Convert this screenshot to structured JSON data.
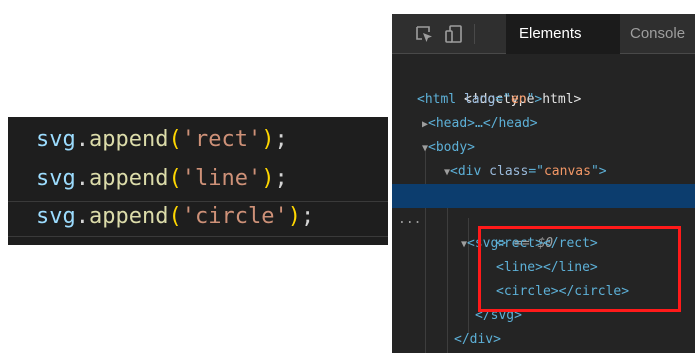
{
  "code_panel": {
    "lines": [
      {
        "obj": "svg",
        "dot": ".",
        "method": "append",
        "open": "(",
        "arg": "'rect'",
        "close": ")",
        "semi": ";"
      },
      {
        "obj": "svg",
        "dot": ".",
        "method": "append",
        "open": "(",
        "arg": "'line'",
        "close": ")",
        "semi": ";"
      },
      {
        "obj": "svg",
        "dot": ".",
        "method": "append",
        "open": "(",
        "arg": "'circle'",
        "close": ")",
        "semi": ";"
      }
    ]
  },
  "devtools": {
    "toolbar": {
      "inspect_icon": "inspect-element-icon",
      "device_icon": "device-toolbar-icon",
      "tabs": [
        {
          "label": "Elements",
          "active": true
        },
        {
          "label": "Console",
          "active": false
        }
      ]
    },
    "tree": {
      "doctype": "<!doctype html>",
      "html_open": "<html",
      "html_attr_name": "lang",
      "html_attr_eq": "=\"",
      "html_attr_val": "en",
      "html_attr_end": "\">",
      "head": "<head>…</head>",
      "body_open": "<body>",
      "div_open": "<div",
      "div_attr_name": "class",
      "div_attr_eq": "=\"",
      "div_attr_val": "canvas",
      "div_attr_end": "\">",
      "row_ellipsis": "...",
      "svg_open": "<svg>",
      "svg_selected_marker": " == $0",
      "rect": "<rect></rect>",
      "line": "<line></line>",
      "circle": "<circle></circle>",
      "svg_close": "</svg>",
      "div_close": "</div>"
    },
    "highlight_color": "#ff1a1a"
  },
  "colors": {
    "editor_bg": "#1e1e1e",
    "devtools_bg": "#242424",
    "selected_row": "#0c3d6e",
    "tag_color": "#5db0d7",
    "attr_value": "#f29766",
    "string_color": "#ce9178",
    "function_color": "#dcdcaa",
    "bracket_color": "#ffd700"
  }
}
